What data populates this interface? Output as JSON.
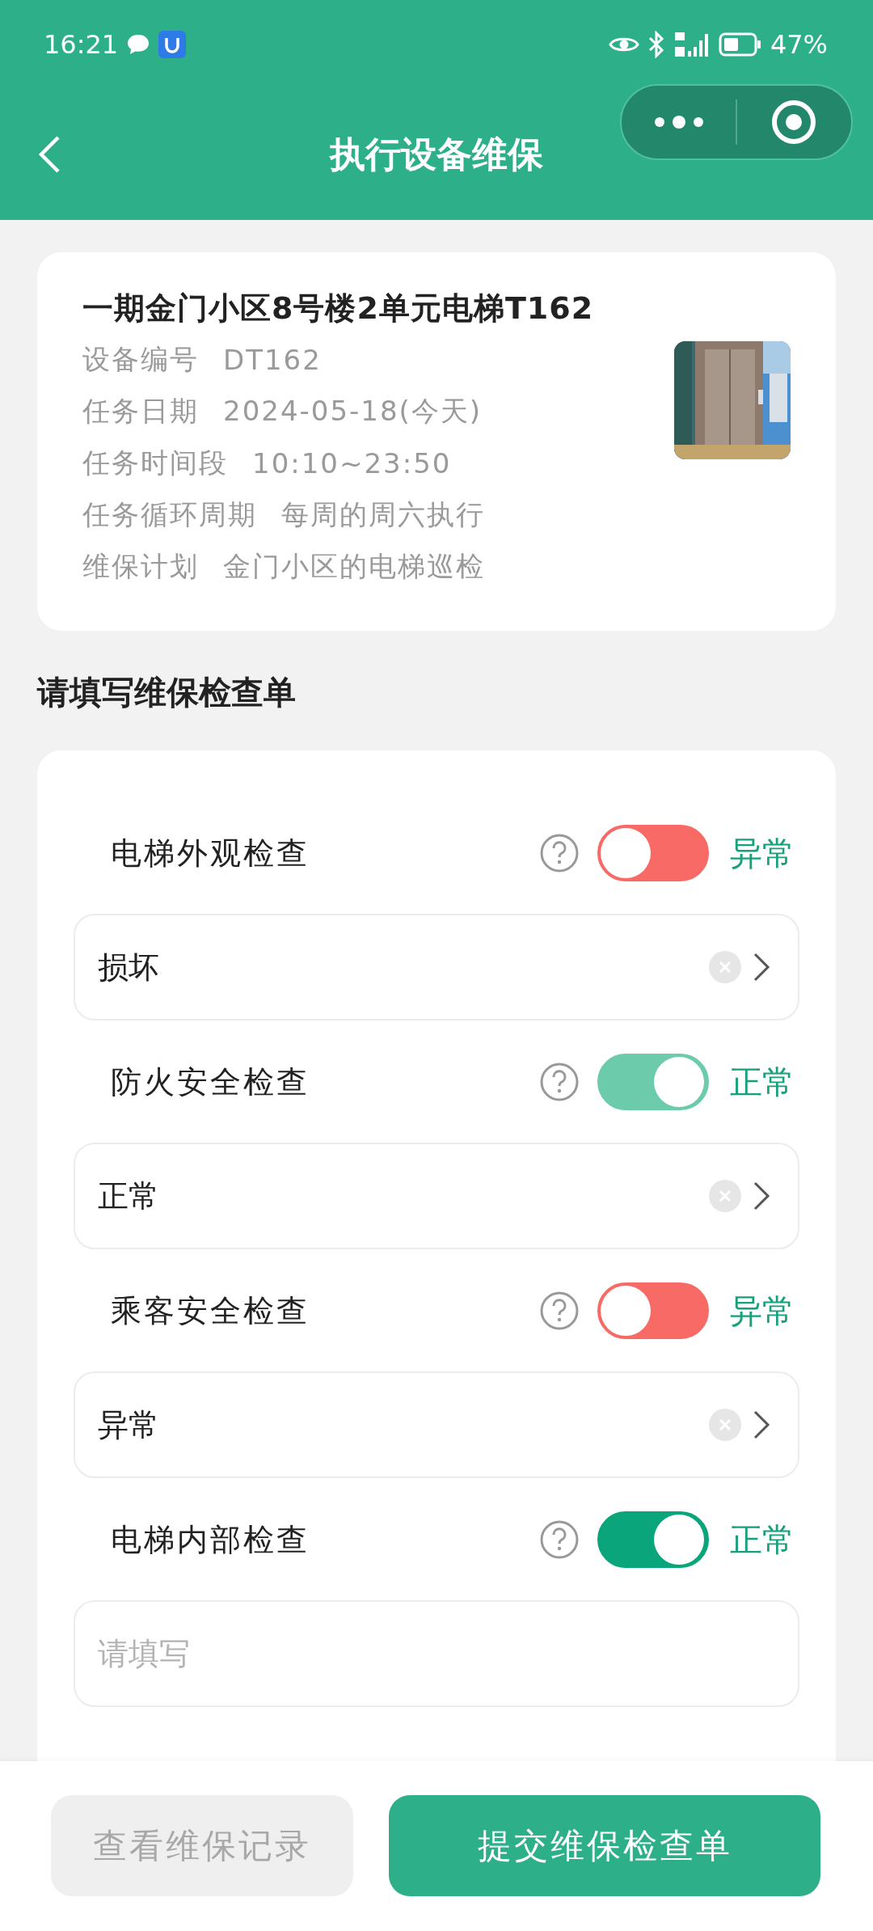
{
  "status_bar": {
    "time": "16:21",
    "battery": "47%"
  },
  "header": {
    "title": "执行设备维保"
  },
  "device": {
    "title": "一期金门小区8号楼2单元电梯T162",
    "fields": [
      {
        "label": "设备编号",
        "value": "DT162"
      },
      {
        "label": "任务日期",
        "value": "2024-05-18(今天)"
      },
      {
        "label": "任务时间段",
        "value": "10:10~23:50"
      },
      {
        "label": "任务循环周期",
        "value": "每周的周六执行"
      },
      {
        "label": "维保计划",
        "value": "金门小区的电梯巡检"
      }
    ]
  },
  "checklist": {
    "title": "请填写维保检查单",
    "items": [
      {
        "label": "电梯外观检查",
        "on": false,
        "disabled": false,
        "status": "异常",
        "field": {
          "kind": "select",
          "value": "损坏"
        }
      },
      {
        "label": "防火安全检查",
        "on": true,
        "disabled": true,
        "status": "正常",
        "field": {
          "kind": "select",
          "value": "正常"
        }
      },
      {
        "label": "乘客安全检查",
        "on": false,
        "disabled": false,
        "status": "异常",
        "field": {
          "kind": "select",
          "value": "异常"
        }
      },
      {
        "label": "电梯内部检查",
        "on": true,
        "disabled": false,
        "status": "正常",
        "field": {
          "kind": "text",
          "placeholder": "请填写"
        }
      }
    ]
  },
  "actions": [
    {
      "label": "查看维保记录",
      "kind": "secondary"
    },
    {
      "label": "提交维保检查单",
      "kind": "primary"
    }
  ]
}
